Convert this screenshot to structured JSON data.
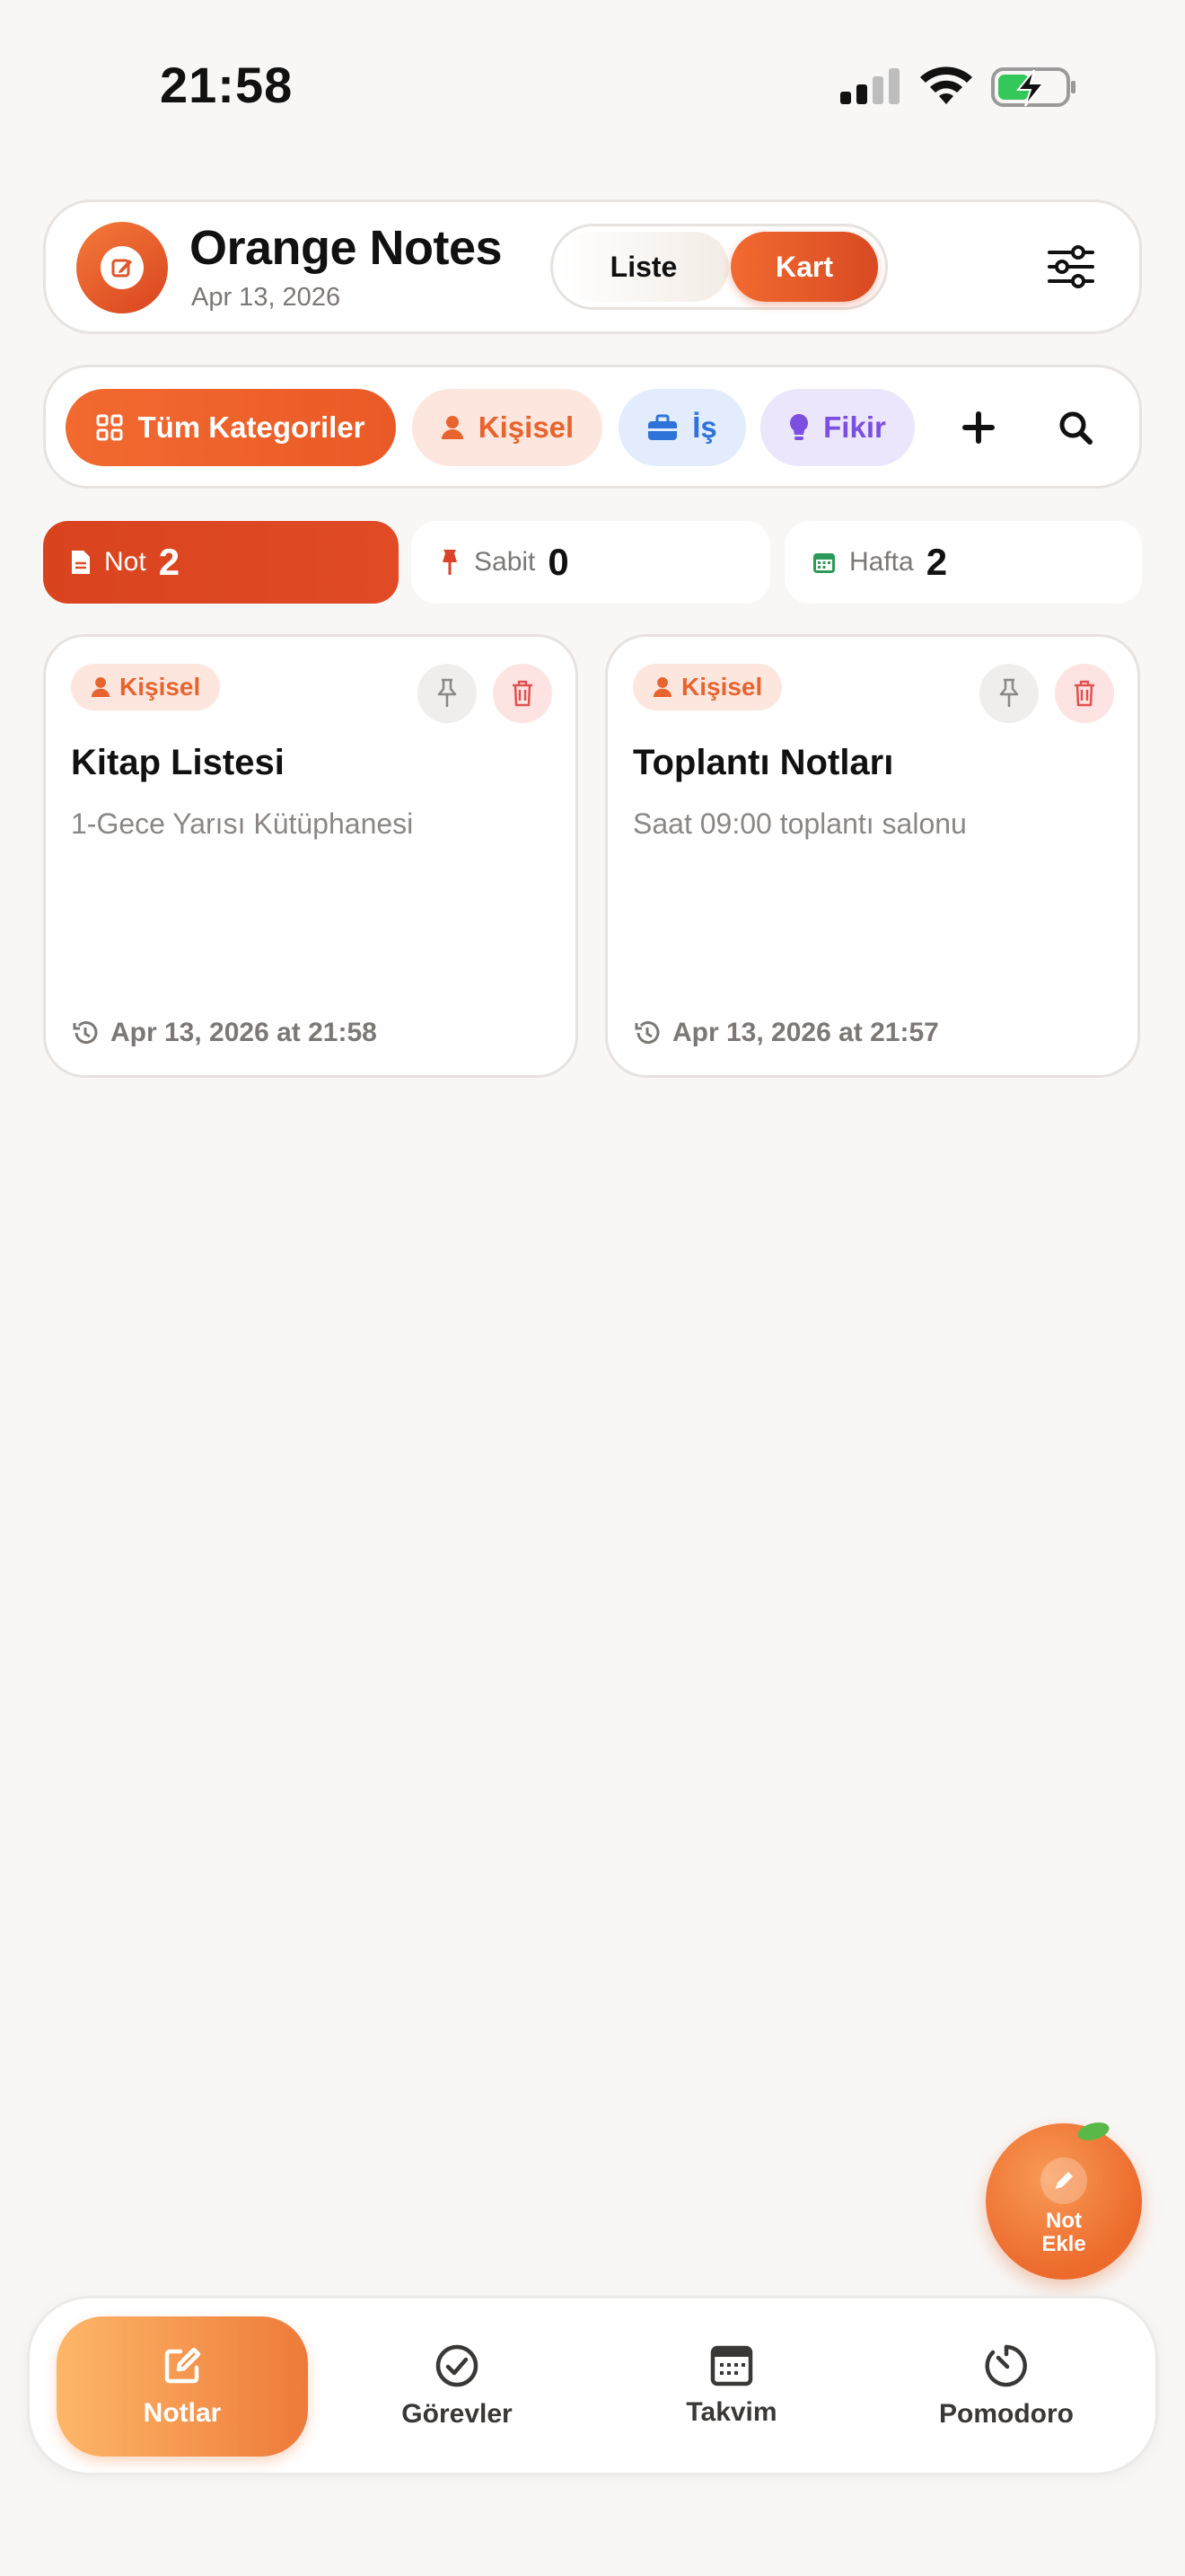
{
  "status_bar": {
    "time": "21:58"
  },
  "header": {
    "title": "Orange Notes",
    "date": "Apr 13, 2026",
    "view_toggle": {
      "list_label": "Liste",
      "card_label": "Kart",
      "selected": "Kart"
    }
  },
  "categories": {
    "all_label": "Tüm Kategoriler",
    "items": [
      {
        "label": "Kişisel",
        "icon": "person-icon",
        "color": "#e8642f"
      },
      {
        "label": "İş",
        "icon": "briefcase-icon",
        "color": "#2f73d9"
      },
      {
        "label": "Fikir",
        "icon": "lightbulb-icon",
        "color": "#7b4fe0"
      }
    ],
    "selected": "Tüm Kategoriler"
  },
  "stats": [
    {
      "label": "Not",
      "value": "2",
      "icon": "document-icon"
    },
    {
      "label": "Sabit",
      "value": "0",
      "icon": "pin-icon"
    },
    {
      "label": "Hafta",
      "value": "2",
      "icon": "calendar-icon"
    }
  ],
  "notes": [
    {
      "category": "Kişisel",
      "title": "Kitap Listesi",
      "body": "1-Gece Yarısı Kütüphanesi",
      "timestamp": "Apr 13, 2026 at 21:58"
    },
    {
      "category": "Kişisel",
      "title": "Toplantı Notları",
      "body": "Saat 09:00 toplantı salonu",
      "timestamp": "Apr 13, 2026 at 21:57"
    }
  ],
  "fab": {
    "line1": "Not",
    "line2": "Ekle"
  },
  "bottom_nav": {
    "items": [
      {
        "label": "Notlar",
        "icon": "edit-square-icon"
      },
      {
        "label": "Görevler",
        "icon": "check-circle-icon"
      },
      {
        "label": "Takvim",
        "icon": "calendar-icon"
      },
      {
        "label": "Pomodoro",
        "icon": "timer-icon"
      }
    ],
    "selected": "Notlar"
  },
  "colors": {
    "accent": "#ec6a2c",
    "accent_dark": "#d9441f",
    "background": "#f8f7f6"
  }
}
